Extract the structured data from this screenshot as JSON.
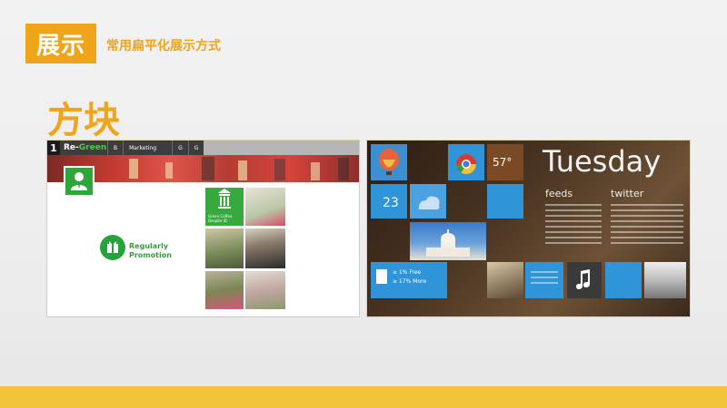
{
  "header": {
    "badge": "展示",
    "subtitle": "常用扁平化展示方式"
  },
  "section": {
    "title": "方块"
  },
  "left_shot": {
    "nav": {
      "number": "1",
      "brand_prefix": "Re-",
      "brand_suffix": "Green",
      "items": [
        "B",
        "Marketing",
        "G",
        "G"
      ]
    },
    "tile_caption": "Green Coffee Despite ID",
    "promo": {
      "line1": "Regularly",
      "line2": "Promotion"
    }
  },
  "right_shot": {
    "day": "Tuesday",
    "feeds": "feeds",
    "twitter": "twitter",
    "temp": "57°",
    "calendar_num": "23",
    "list_line1": "≥ 1% Free",
    "list_line2": "≥ 17% More"
  },
  "colors": {
    "accent": "#f0a41a",
    "bottom_bar": "#f3c33a",
    "green": "#2fa63a",
    "metro_blue": "#2f95d8"
  }
}
